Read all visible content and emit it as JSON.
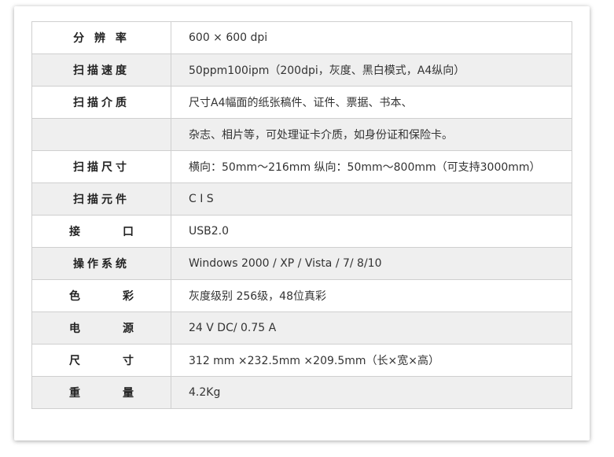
{
  "specs": [
    {
      "label": "分 辨 率",
      "value": "600 × 600 dpi",
      "shaded": false,
      "wide": false
    },
    {
      "label": "扫描速度",
      "value": "50ppm100ipm（200dpi，灰度、黑白模式，A4纵向）",
      "shaded": true,
      "wide": false
    },
    {
      "label": "扫描介质",
      "value": "尺寸A4幅面的纸张稿件、证件、票据、书本、",
      "shaded": false,
      "wide": false
    },
    {
      "label": "",
      "value": "杂志、相片等，可处理证卡介质，如身份证和保险卡。",
      "shaded": true,
      "wide": false
    },
    {
      "label": "扫描尺寸",
      "value": "横向：50mm～216mm 纵向：50mm～800mm（可支持3000mm）",
      "shaded": false,
      "wide": false
    },
    {
      "label": "扫描元件",
      "value": "C I S",
      "shaded": true,
      "wide": false
    },
    {
      "label": "接口",
      "value": "USB2.0",
      "shaded": false,
      "wide": true
    },
    {
      "label": "操作系统",
      "value": "Windows 2000 / XP / Vista / 7/ 8/10",
      "shaded": true,
      "wide": false
    },
    {
      "label": "色彩",
      "value": "灰度级别 256级，48位真彩",
      "shaded": false,
      "wide": true
    },
    {
      "label": "电源",
      "value": "24 V DC/ 0.75 A",
      "shaded": true,
      "wide": true
    },
    {
      "label": "尺寸",
      "value": "312 mm ×232.5mm ×209.5mm（长×宽×高）",
      "shaded": false,
      "wide": true
    },
    {
      "label": "重量",
      "value": "4.2Kg",
      "shaded": true,
      "wide": true
    }
  ]
}
